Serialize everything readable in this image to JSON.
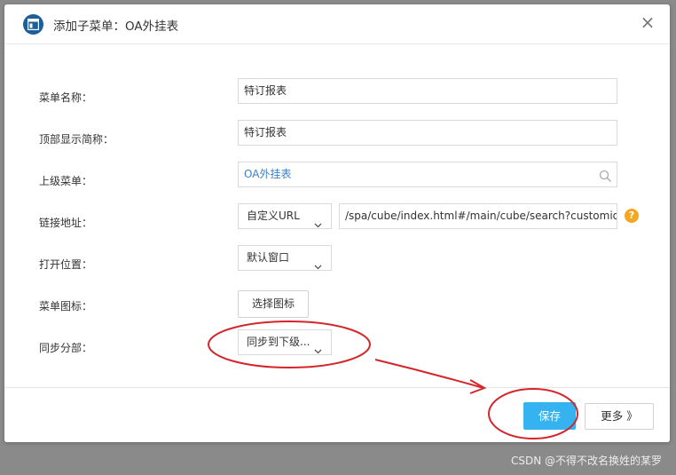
{
  "dialog": {
    "title": "添加子菜单：OA外挂表",
    "close_label": "×"
  },
  "form": {
    "menu_name": {
      "label": "菜单名称：",
      "value": "特订报表"
    },
    "top_name": {
      "label": "顶部显示简称：",
      "value": "特订报表"
    },
    "parent_menu": {
      "label": "上级菜单：",
      "value": "OA外挂表"
    },
    "link": {
      "label": "链接地址：",
      "type_value": "自定义URL",
      "url_value": "/spa/cube/index.html#/main/cube/search?customid=",
      "help_label": "?"
    },
    "open_position": {
      "label": "打开位置：",
      "value": "默认窗口"
    },
    "menu_icon": {
      "label": "菜单图标：",
      "button_label": "选择图标"
    },
    "sync": {
      "label": "同步分部：",
      "value": "同步到下级..."
    }
  },
  "footer": {
    "save_label": "保存",
    "more_label": "更多 》"
  },
  "watermark": "CSDN @不得不改名换姓的某罗",
  "colors": {
    "primary": "#35b3f0",
    "link_text": "#3b7fc4",
    "help_icon": "#f4a623",
    "annotation": "#d4262a",
    "header_icon": "#1f5e98"
  },
  "icons": [
    "window-icon",
    "close-icon",
    "search-icon",
    "chevron-down-icon",
    "help-icon",
    "double-chevron-right-icon"
  ]
}
